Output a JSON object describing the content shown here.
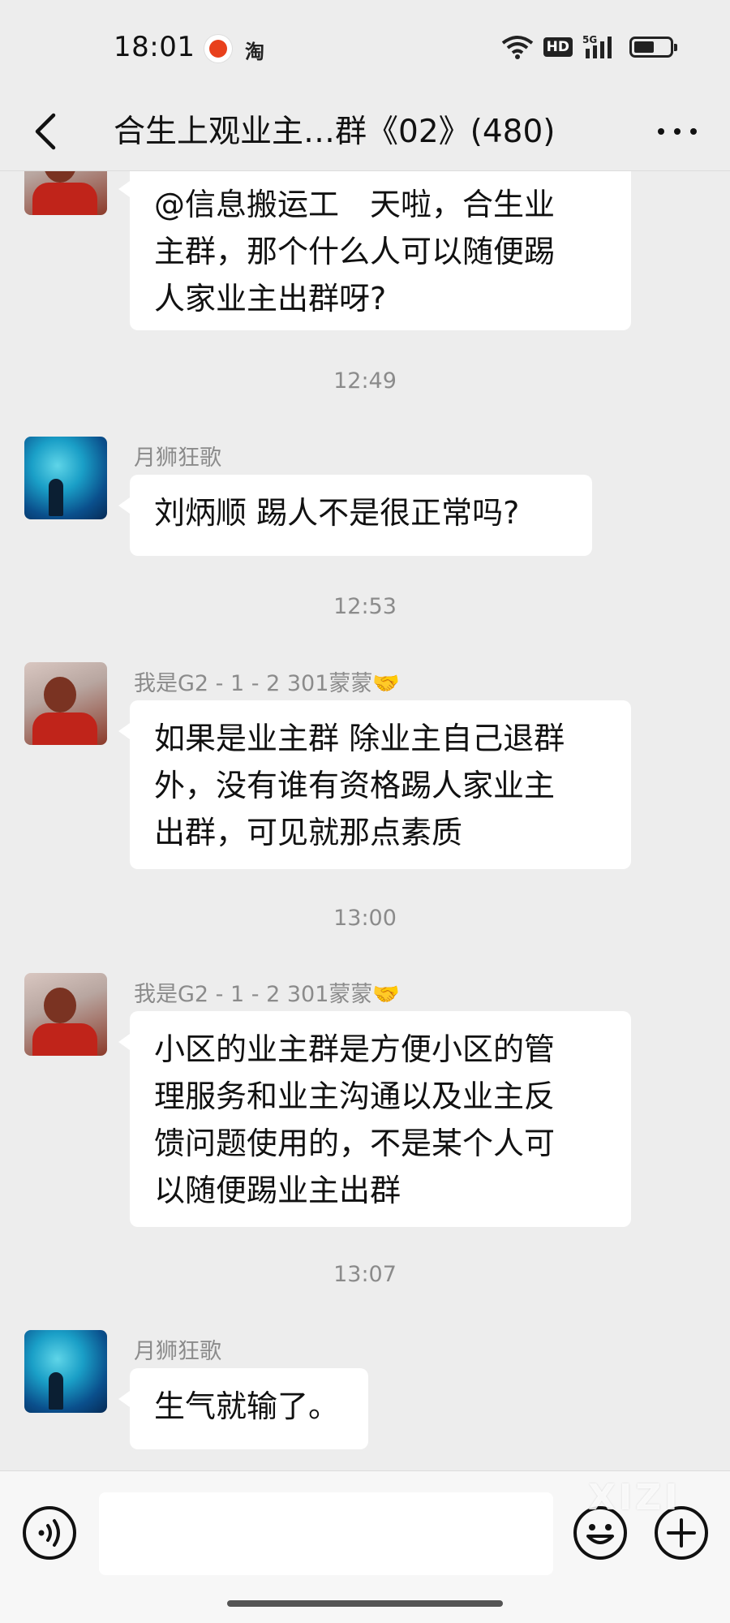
{
  "status_bar": {
    "time": "18:01",
    "app_label": "淘",
    "network_badge": "HD",
    "network_type": "5G"
  },
  "header": {
    "title": "合生上观业主…群《02》(480)"
  },
  "messages": [
    {
      "type": "message",
      "sender": "",
      "avatar": "red-avatar",
      "text": "@信息搬运工　天啦，合生业主群，那个什么人可以随便踢人家业主出群呀?"
    },
    {
      "type": "time",
      "text": "12:49"
    },
    {
      "type": "message",
      "sender": "月狮狂歌",
      "avatar": "ocean-avatar",
      "text": "刘炳顺 踢人不是很正常吗?"
    },
    {
      "type": "time",
      "text": "12:53"
    },
    {
      "type": "message",
      "sender": "我是G2 - 1 - 2 301蒙蒙🤝",
      "avatar": "red-avatar",
      "text": "如果是业主群 除业主自己退群外，没有谁有资格踢人家业主出群，可见就那点素质"
    },
    {
      "type": "time",
      "text": "13:00"
    },
    {
      "type": "message",
      "sender": "我是G2 - 1 - 2 301蒙蒙🤝",
      "avatar": "red-avatar",
      "text": "小区的业主群是方便小区的管理服务和业主沟通以及业主反馈问题使用的，不是某个人可以随便踢业主出群"
    },
    {
      "type": "time",
      "text": "13:07"
    },
    {
      "type": "message",
      "sender": "月狮狂歌",
      "avatar": "ocean-avatar",
      "text": "生气就输了。"
    }
  ],
  "msg1": {
    "text": "@信息搬运工　天啦，合生业\n主群，那个什么人可以随便踢\n人家业主出群呀?"
  },
  "t1": "12:49",
  "msg2": {
    "sender": "月狮狂歌",
    "text": "刘炳顺 踢人不是很正常吗?"
  },
  "t2": "12:53",
  "msg3": {
    "sender": "我是G2 - 1 - 2 301蒙蒙🤝",
    "text": "如果是业主群 除业主自己退群\n外，没有谁有资格踢人家业主\n出群，可见就那点素质"
  },
  "t3": "13:00",
  "msg4": {
    "sender": "我是G2 - 1 - 2 301蒙蒙🤝",
    "text": "小区的业主群是方便小区的管\n理服务和业主沟通以及业主反\n馈问题使用的，不是某个人可\n以随便踢业主出群"
  },
  "t4": "13:07",
  "msg5": {
    "sender": "月狮狂歌",
    "text": "生气就输了。"
  },
  "input": {
    "placeholder": ""
  },
  "watermark": "XIZI",
  "colors": {
    "background": "#ededed",
    "bubble": "#ffffff",
    "meta_text": "#8b8b8b"
  }
}
